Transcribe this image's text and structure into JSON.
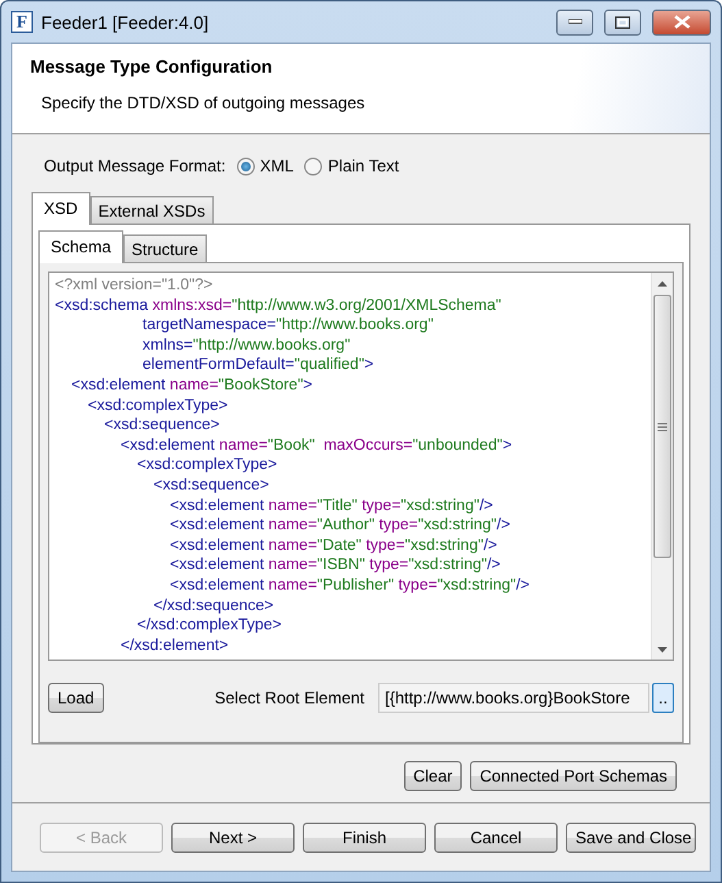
{
  "window": {
    "logo": "F",
    "title": "Feeder1 [Feeder:4.0]"
  },
  "header": {
    "title": "Message Type Configuration",
    "description": "Specify the DTD/XSD of outgoing messages"
  },
  "format": {
    "label": "Output Message Format:",
    "options": [
      {
        "label": "XML",
        "selected": true
      },
      {
        "label": "Plain Text",
        "selected": false
      }
    ]
  },
  "tabs": [
    {
      "label": "XSD",
      "selected": true
    },
    {
      "label": "External XSDs",
      "selected": false
    }
  ],
  "subtabs": [
    {
      "label": "Schema",
      "selected": true
    },
    {
      "label": "Structure",
      "selected": false
    }
  ],
  "editor": {
    "lines": [
      {
        "segments": [
          {
            "kind": "decl",
            "text": "<?xml version=\"1.0\"?>"
          }
        ]
      },
      {
        "segments": [
          {
            "kind": "tag",
            "text": "<xsd:schema"
          },
          {
            "kind": "attr",
            "text": " xmlns:xsd="
          },
          {
            "kind": "value",
            "text": "\"http://www.w3.org/2001/XMLSchema\""
          }
        ],
        "continuation": [
          {
            "segments": [
              {
                "kind": "tag",
                "text": "targetNamespace="
              },
              {
                "kind": "value",
                "text": "\"http://www.books.org\""
              }
            ]
          },
          {
            "segments": [
              {
                "kind": "tag",
                "text": "xmlns="
              },
              {
                "kind": "value",
                "text": "\"http://www.books.org\""
              }
            ]
          },
          {
            "segments": [
              {
                "kind": "tag",
                "text": "elementFormDefault="
              },
              {
                "kind": "value",
                "text": "\"qualified\""
              },
              {
                "kind": "tag",
                "text": ">"
              }
            ]
          }
        ],
        "children": [
          {
            "segments": [
              {
                "kind": "tag",
                "text": "<xsd:element"
              },
              {
                "kind": "attr",
                "text": " name="
              },
              {
                "kind": "value",
                "text": "\"BookStore\""
              },
              {
                "kind": "tag",
                "text": ">"
              }
            ],
            "children": [
              {
                "segments": [
                  {
                    "kind": "tag",
                    "text": "<xsd:complexType>"
                  }
                ],
                "children": [
                  {
                    "segments": [
                      {
                        "kind": "tag",
                        "text": "<xsd:sequence>"
                      }
                    ],
                    "children": [
                      {
                        "segments": [
                          {
                            "kind": "tag",
                            "text": "<xsd:element"
                          },
                          {
                            "kind": "attr",
                            "text": " name="
                          },
                          {
                            "kind": "value",
                            "text": "\"Book\""
                          },
                          {
                            "kind": "attr",
                            "text": "  maxOccurs="
                          },
                          {
                            "kind": "value",
                            "text": "\"unbounded\""
                          },
                          {
                            "kind": "tag",
                            "text": ">"
                          }
                        ],
                        "children": [
                          {
                            "segments": [
                              {
                                "kind": "tag",
                                "text": "<xsd:complexType>"
                              }
                            ],
                            "children": [
                              {
                                "segments": [
                                  {
                                    "kind": "tag",
                                    "text": "<xsd:sequence>"
                                  }
                                ],
                                "children": [
                                  {
                                    "segments": [
                                      {
                                        "kind": "tag",
                                        "text": "<xsd:element"
                                      },
                                      {
                                        "kind": "attr",
                                        "text": " name="
                                      },
                                      {
                                        "kind": "value",
                                        "text": "\"Title\""
                                      },
                                      {
                                        "kind": "attr",
                                        "text": " type="
                                      },
                                      {
                                        "kind": "value",
                                        "text": "\"xsd:string\""
                                      },
                                      {
                                        "kind": "tag",
                                        "text": "/>"
                                      }
                                    ]
                                  },
                                  {
                                    "segments": [
                                      {
                                        "kind": "tag",
                                        "text": "<xsd:element"
                                      },
                                      {
                                        "kind": "attr",
                                        "text": " name="
                                      },
                                      {
                                        "kind": "value",
                                        "text": "\"Author\""
                                      },
                                      {
                                        "kind": "attr",
                                        "text": " type="
                                      },
                                      {
                                        "kind": "value",
                                        "text": "\"xsd:string\""
                                      },
                                      {
                                        "kind": "tag",
                                        "text": "/>"
                                      }
                                    ]
                                  },
                                  {
                                    "segments": [
                                      {
                                        "kind": "tag",
                                        "text": "<xsd:element"
                                      },
                                      {
                                        "kind": "attr",
                                        "text": " name="
                                      },
                                      {
                                        "kind": "value",
                                        "text": "\"Date\""
                                      },
                                      {
                                        "kind": "attr",
                                        "text": " type="
                                      },
                                      {
                                        "kind": "value",
                                        "text": "\"xsd:string\""
                                      },
                                      {
                                        "kind": "tag",
                                        "text": "/>"
                                      }
                                    ]
                                  },
                                  {
                                    "segments": [
                                      {
                                        "kind": "tag",
                                        "text": "<xsd:element"
                                      },
                                      {
                                        "kind": "attr",
                                        "text": " name="
                                      },
                                      {
                                        "kind": "value",
                                        "text": "\"ISBN\""
                                      },
                                      {
                                        "kind": "attr",
                                        "text": " type="
                                      },
                                      {
                                        "kind": "value",
                                        "text": "\"xsd:string\""
                                      },
                                      {
                                        "kind": "tag",
                                        "text": "/>"
                                      }
                                    ]
                                  },
                                  {
                                    "segments": [
                                      {
                                        "kind": "tag",
                                        "text": "<xsd:element"
                                      },
                                      {
                                        "kind": "attr",
                                        "text": " name="
                                      },
                                      {
                                        "kind": "value",
                                        "text": "\"Publisher\""
                                      },
                                      {
                                        "kind": "attr",
                                        "text": " type="
                                      },
                                      {
                                        "kind": "value",
                                        "text": "\"xsd:string\""
                                      },
                                      {
                                        "kind": "tag",
                                        "text": "/>"
                                      }
                                    ]
                                  }
                                ]
                              },
                              {
                                "segments": [
                                  {
                                    "kind": "tag",
                                    "text": "</xsd:sequence>"
                                  }
                                ]
                              }
                            ]
                          },
                          {
                            "segments": [
                              {
                                "kind": "tag",
                                "text": "</xsd:complexType>"
                              }
                            ]
                          }
                        ]
                      },
                      {
                        "segments": [
                          {
                            "kind": "tag",
                            "text": "</xsd:element>"
                          }
                        ]
                      }
                    ]
                  }
                ]
              }
            ]
          }
        ]
      }
    ]
  },
  "load_button": "Load",
  "root_element": {
    "label": "Select Root Element",
    "value": "[{http://www.books.org}BookStore",
    "browse": ".."
  },
  "actions": [
    "Clear",
    "Connected Port Schemas"
  ],
  "buttons": [
    {
      "label": "< Back",
      "disabled": true
    },
    {
      "label": "Next >",
      "disabled": false
    },
    {
      "label": "Finish",
      "disabled": false
    },
    {
      "label": "Cancel",
      "disabled": false
    },
    {
      "label": "Save and Close",
      "disabled": false
    }
  ]
}
